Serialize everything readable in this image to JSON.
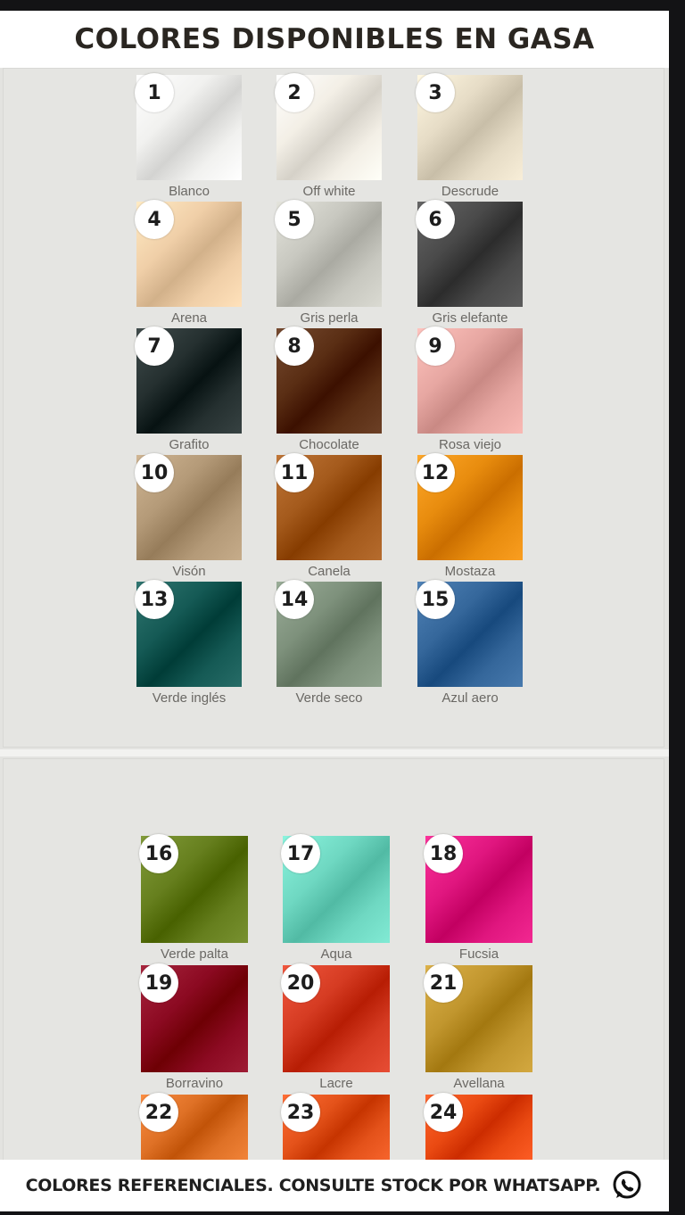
{
  "title": "COLORES DISPONIBLES EN GASA",
  "footer": {
    "text": "COLORES REFERENCIALES. CONSULTE STOCK POR WHATSAPP.",
    "icon": "whatsapp-icon"
  },
  "swatches": [
    {
      "num": "1",
      "name": "Blanco",
      "color": "#f1f1ef"
    },
    {
      "num": "2",
      "name": "Off white",
      "color": "#f3efe6"
    },
    {
      "num": "3",
      "name": "Descrude",
      "color": "#e6dcc6"
    },
    {
      "num": "4",
      "name": "Arena",
      "color": "#f0cfa8"
    },
    {
      "num": "5",
      "name": "Gris perla",
      "color": "#c8c8c0"
    },
    {
      "num": "6",
      "name": "Gris elefante",
      "color": "#4a4a4a"
    },
    {
      "num": "7",
      "name": "Grafito",
      "color": "#253030"
    },
    {
      "num": "8",
      "name": "Chocolate",
      "color": "#5a2e14"
    },
    {
      "num": "9",
      "name": "Rosa viejo",
      "color": "#e7a7a2"
    },
    {
      "num": "10",
      "name": "Visón",
      "color": "#b49a78"
    },
    {
      "num": "11",
      "name": "Canela",
      "color": "#a45a1c"
    },
    {
      "num": "12",
      "name": "Mostaza",
      "color": "#e88c0e"
    },
    {
      "num": "13",
      "name": "Verde inglés",
      "color": "#155a55"
    },
    {
      "num": "14",
      "name": "Verde seco",
      "color": "#7e917c"
    },
    {
      "num": "15",
      "name": "Azul aero",
      "color": "#35679b"
    },
    {
      "num": "16",
      "name": "Verde palta",
      "color": "#667f1e"
    },
    {
      "num": "17",
      "name": "Aqua",
      "color": "#6fd8c2"
    },
    {
      "num": "18",
      "name": "Fucsia",
      "color": "#e0167f"
    },
    {
      "num": "19",
      "name": "Borravino",
      "color": "#8c0a22"
    },
    {
      "num": "20",
      "name": "Lacre",
      "color": "#d53b22"
    },
    {
      "num": "21",
      "name": "Avellana",
      "color": "#c1962e"
    },
    {
      "num": "22",
      "name": "",
      "color": "#df7126"
    },
    {
      "num": "23",
      "name": "",
      "color": "#e4521a"
    },
    {
      "num": "24",
      "name": "",
      "color": "#ea4a12"
    }
  ]
}
